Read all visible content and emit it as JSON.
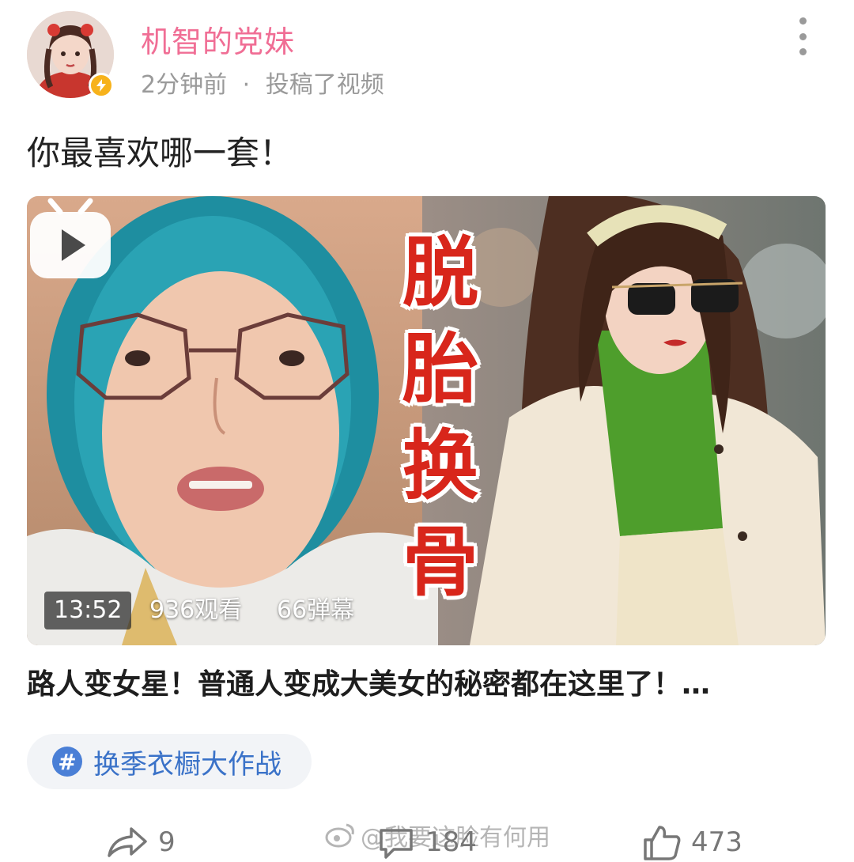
{
  "header": {
    "username": "机智的党妹",
    "time": "2分钟前",
    "separator": "·",
    "action": "投稿了视频"
  },
  "post": {
    "text": "你最喜欢哪一套！"
  },
  "video": {
    "cover_title_chars": [
      "脱",
      "胎",
      "换",
      "骨"
    ],
    "duration": "13:52",
    "views": "936观看",
    "danmaku": "66弹幕",
    "title": "路人变女星！普通人变成大美女的秘密都在这里了！…"
  },
  "topic": {
    "icon": "#",
    "label": "换季衣橱大作战"
  },
  "actions": {
    "share_count": "9",
    "comment_count": "184",
    "like_count": "473"
  },
  "watermark": "@我要这脸有何用",
  "icons": {
    "more": "more-vertical-icon",
    "share": "share-icon",
    "comment": "comment-icon",
    "like": "thumbs-up-icon",
    "play": "play-icon",
    "verify": "lightning-icon",
    "weibo": "weibo-logo-icon"
  },
  "colors": {
    "username": "#f06e95",
    "cover_title": "#d8261b",
    "topic": "#3a72c8",
    "verify_badge": "#f7b21b"
  }
}
